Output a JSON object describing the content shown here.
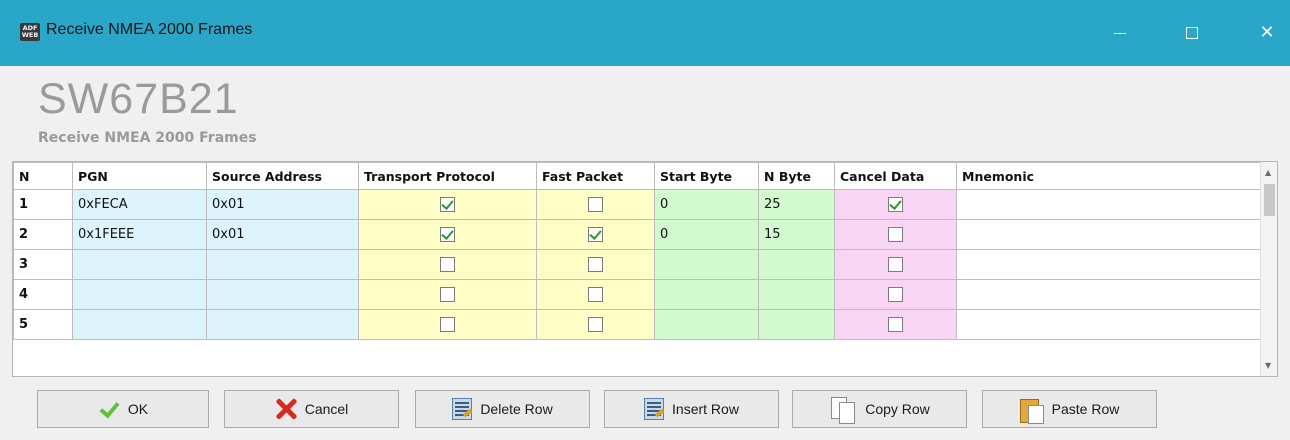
{
  "window": {
    "title": "Receive NMEA 2000 Frames",
    "icon_text": "ADF WEB",
    "minimize_icon": "minimize-icon",
    "maximize_icon": "maximize-icon",
    "close_glyph": "✕"
  },
  "header": {
    "title": "SW67B21",
    "subtitle": "Receive NMEA 2000 Frames"
  },
  "grid": {
    "columns": [
      "N",
      "PGN",
      "Source Address",
      "Transport Protocol",
      "Fast Packet",
      "Start Byte",
      "N Byte",
      "Cancel Data",
      "Mnemonic"
    ],
    "rows": [
      {
        "n": "1",
        "pgn": "0xFECA",
        "src": "0x01",
        "tp": true,
        "fp": false,
        "sb": "0",
        "nb": "25",
        "cd": true,
        "mn": ""
      },
      {
        "n": "2",
        "pgn": "0x1FEEE",
        "src": "0x01",
        "tp": true,
        "fp": true,
        "sb": "0",
        "nb": "15",
        "cd": false,
        "mn": ""
      },
      {
        "n": "3",
        "pgn": "",
        "src": "",
        "tp": false,
        "fp": false,
        "sb": "",
        "nb": "",
        "cd": false,
        "mn": ""
      },
      {
        "n": "4",
        "pgn": "",
        "src": "",
        "tp": false,
        "fp": false,
        "sb": "",
        "nb": "",
        "cd": false,
        "mn": ""
      },
      {
        "n": "5",
        "pgn": "",
        "src": "",
        "tp": false,
        "fp": false,
        "sb": "",
        "nb": "",
        "cd": false,
        "mn": ""
      }
    ]
  },
  "buttons": {
    "ok": "OK",
    "cancel": "Cancel",
    "delete_row": "Delete Row",
    "insert_row": "Insert Row",
    "copy_row": "Copy Row",
    "paste_row": "Paste Row"
  },
  "colors": {
    "titlebar": "#2aa6c9",
    "pgn_column": "#ddf4fc",
    "protocol_column": "#fefec6",
    "byte_column": "#d3f9cf",
    "cancel_column": "#f9d5f5"
  }
}
